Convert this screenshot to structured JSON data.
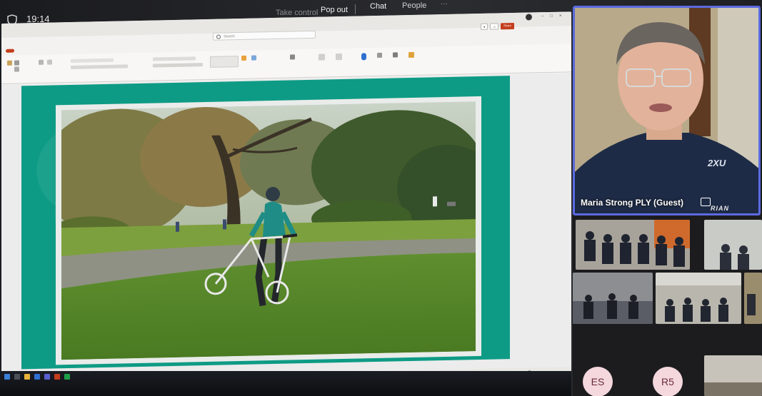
{
  "topbar": {
    "time": "19:14",
    "take_control": "Take control",
    "pop_out": "Pop out",
    "chat": "Chat",
    "people": "People"
  },
  "ppt": {
    "search_placeholder": "Search",
    "share": "Share"
  },
  "participant": {
    "name": "Maria Strong PLY (Guest)",
    "shirt_logo": "2XU",
    "brand_text": "RIAN"
  },
  "participants_initials": [
    "ES",
    "R5"
  ],
  "colors": {
    "slide_teal": "#0e9b85",
    "active_speaker_border": "#5b6ae0",
    "ppt_accent": "#c43e1c",
    "initials_bg": "#f4d8de"
  },
  "icons": [
    "shield-icon",
    "search-icon",
    "raise-hand-icon"
  ]
}
